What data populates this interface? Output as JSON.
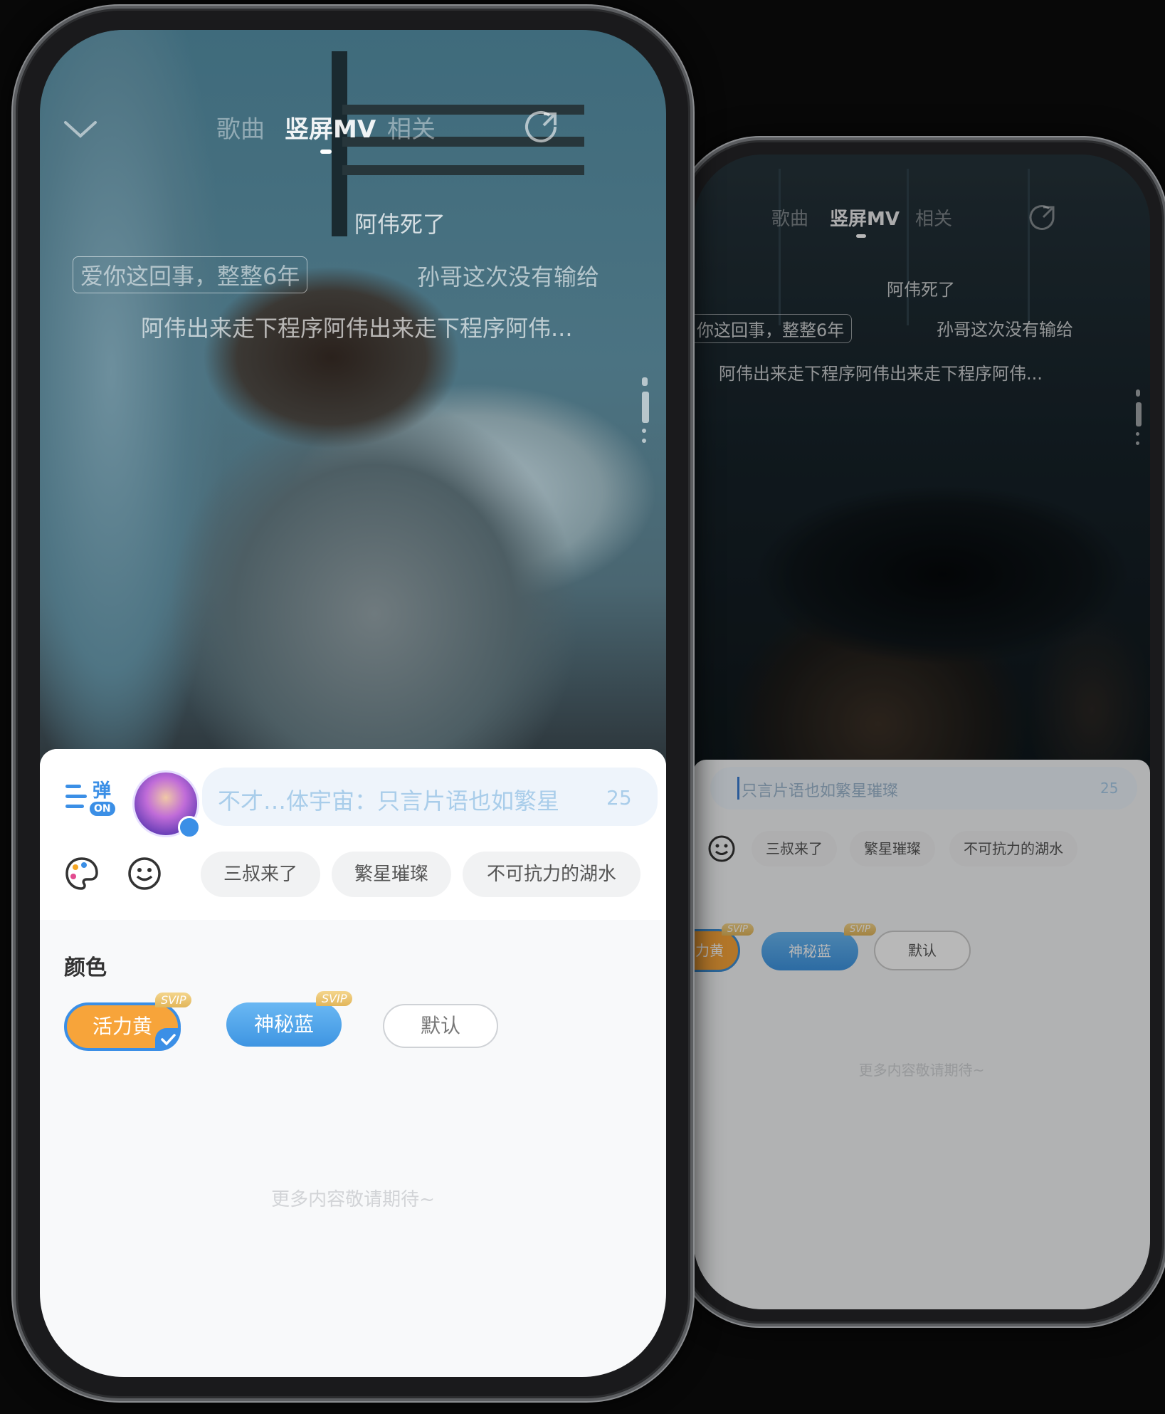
{
  "tabs": [
    "歌曲",
    "竖屏MV",
    "相关"
  ],
  "danmaku": {
    "line1": "阿伟死了",
    "line2_boxed": "爱你这回事，整整6年",
    "line2_boxed_back": "你这回事，整整6年",
    "line2_right": "孙哥这次没有输给",
    "line3": "阿伟出来走下程序阿伟出来走下程序阿伟..."
  },
  "danmaku_toggle": {
    "label": "弹",
    "state": "ON"
  },
  "input": {
    "value": "不才…体宇宙：只言片语也如繁星",
    "value_back": "只言片语也如繁星璀璨",
    "count": "25"
  },
  "quick_phrases": [
    "三叔来了",
    "繁星璀璨",
    "不可抗力的湖水"
  ],
  "color_section": {
    "title": "颜色",
    "options": [
      {
        "label": "活力黄",
        "badge": "SVIP",
        "color": "#f7a43a",
        "selected": true
      },
      {
        "label": "神秘蓝",
        "badge": "SVIP",
        "color": "#4aa7ee",
        "selected": false
      },
      {
        "label": "默认",
        "badge": "",
        "color": "#ffffff",
        "selected": false
      }
    ]
  },
  "footer_note": "更多内容敬请期待~"
}
